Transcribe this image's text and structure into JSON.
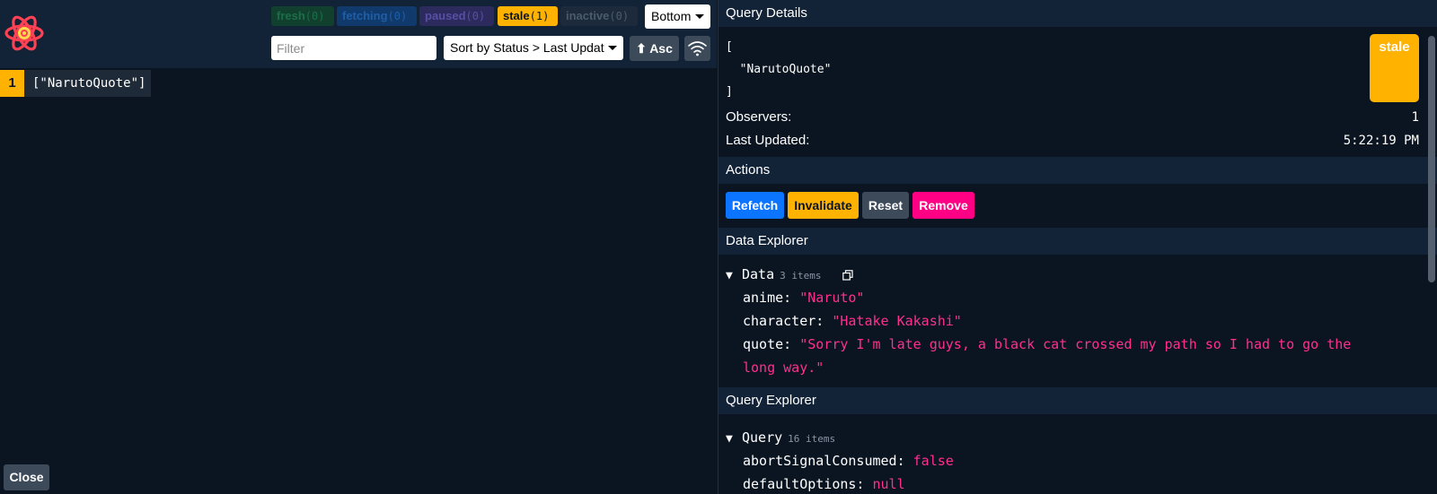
{
  "toolbar": {
    "badges": [
      {
        "label": "fresh",
        "count": "(0)"
      },
      {
        "label": "fetching",
        "count": "(0)"
      },
      {
        "label": "paused",
        "count": "(0)"
      },
      {
        "label": "stale",
        "count": "(1)"
      },
      {
        "label": "inactive",
        "count": "(0)"
      }
    ],
    "position_value": "Bottom",
    "filter_placeholder": "Filter",
    "sort_value": "Sort by Status > Last Updated",
    "order_label": "⬆ Asc"
  },
  "query_list": [
    {
      "observers": "1",
      "key": "[\"NarutoQuote\"]"
    }
  ],
  "close_label": "Close",
  "query_details": {
    "title": "Query Details",
    "key_text": "[\n  \"NarutoQuote\"\n]",
    "status": "stale",
    "observers_label": "Observers:",
    "observers_value": "1",
    "updated_label": "Last Updated:",
    "updated_value": "5:22:19 PM"
  },
  "actions": {
    "title": "Actions",
    "refetch": "Refetch",
    "invalidate": "Invalidate",
    "reset": "Reset",
    "remove": "Remove"
  },
  "data_explorer": {
    "title": "Data Explorer",
    "root_label": "Data",
    "root_count": "3 items",
    "entries": [
      {
        "key": "anime:",
        "value": "\"Naruto\""
      },
      {
        "key": "character:",
        "value": "\"Hatake Kakashi\""
      },
      {
        "key": "quote:",
        "value": "\"Sorry I'm late guys, a black cat crossed my path so I had to go the",
        "value_cont": "long way.\""
      }
    ]
  },
  "query_explorer": {
    "title": "Query Explorer",
    "root_label": "Query",
    "root_count": "16 items",
    "entries": [
      {
        "key": "abortSignalConsumed:",
        "value": "false"
      },
      {
        "key": "defaultOptions:",
        "value": "null"
      }
    ]
  },
  "colors": {
    "stale": "#ffb200",
    "refetch": "#0b75ff",
    "remove": "#ff0085",
    "panel_bg": "#0b1521",
    "header_bg": "#132337"
  }
}
